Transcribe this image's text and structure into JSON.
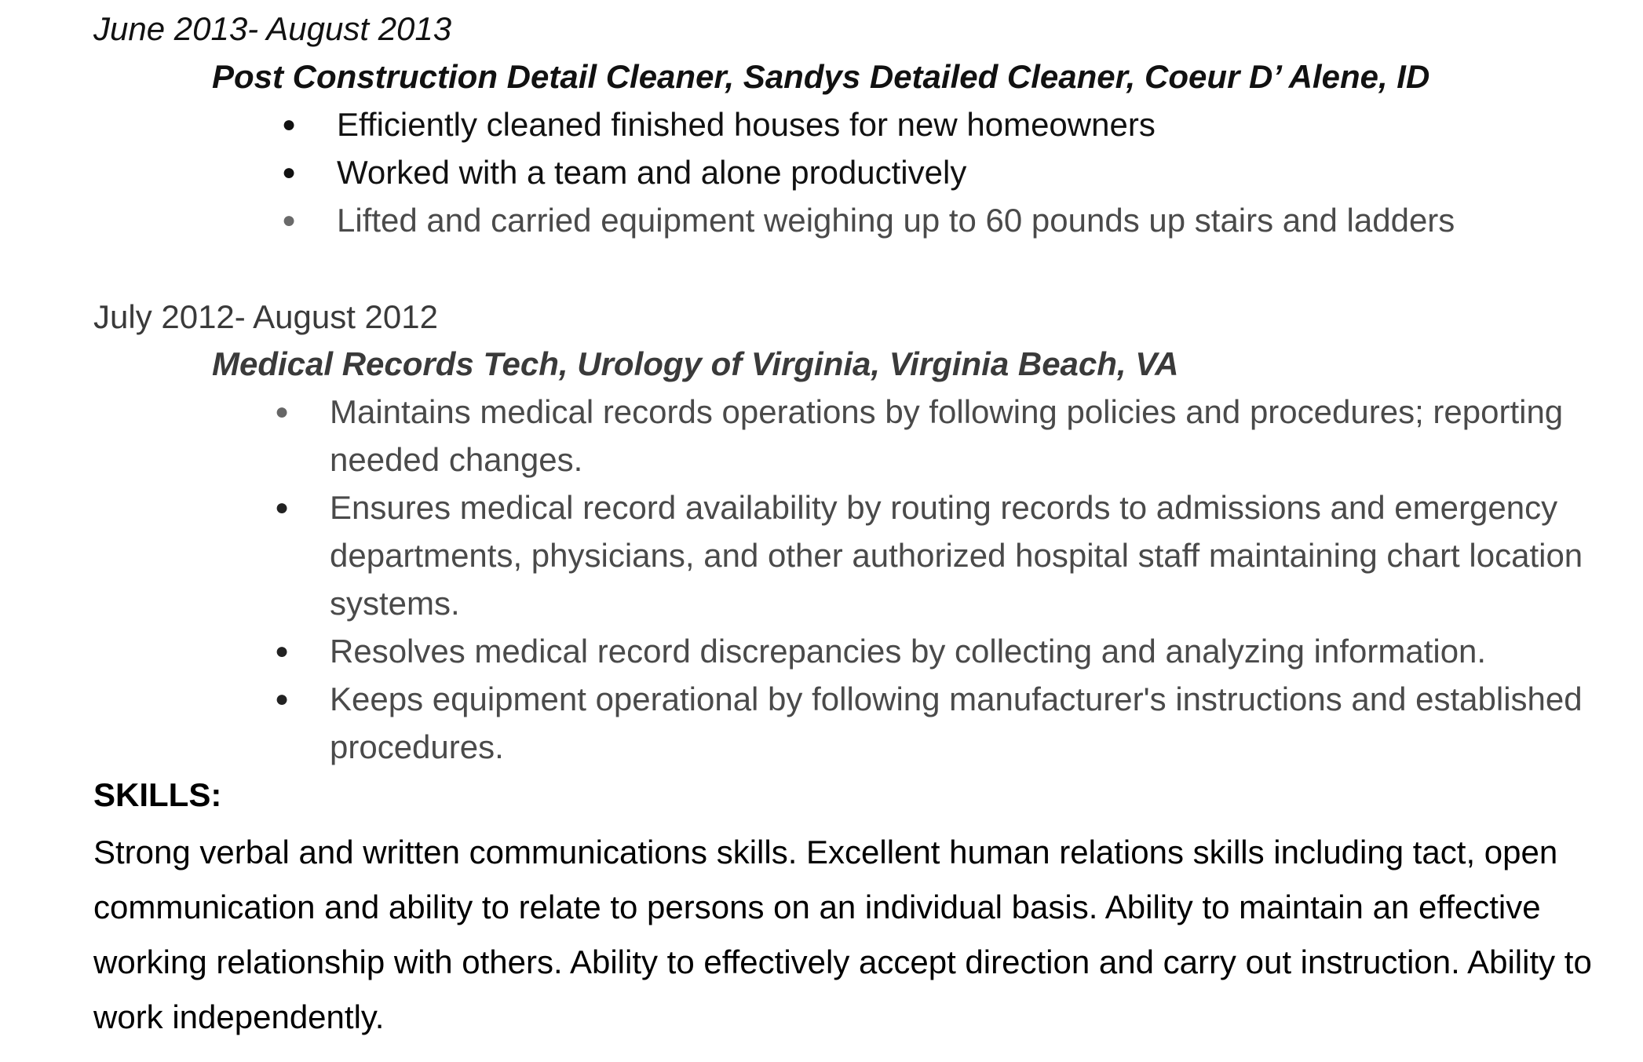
{
  "jobs": [
    {
      "dates": "June 2013- August 2013",
      "title": "Post Construction Detail Cleaner, Sandys Detailed Cleaner, Coeur D’ Alene, ID",
      "bullets": [
        "Efficiently cleaned finished houses for new homeowners",
        "Worked with a team and alone productively",
        "Lifted and carried equipment weighing up to 60 pounds up stairs and ladders"
      ]
    },
    {
      "dates": "July 2012-  August 2012",
      "title": "Medical Records Tech, Urology of Virginia, Virginia Beach, VA",
      "bullets": [
        "Maintains medical records operations by following policies and procedures; reporting needed changes.",
        "Ensures medical record availability by routing records to admissions and emergency departments, physicians, and other authorized hospital staff maintaining chart location systems.",
        "Resolves medical record discrepancies by collecting and analyzing information.",
        "Keeps equipment operational by following manufacturer's instructions and established procedures."
      ]
    }
  ],
  "bullet_glyph": "●",
  "skills": {
    "heading": "SKILLS:",
    "text": "Strong verbal and written communications skills. Excellent human relations skills including tact, open communication and ability to relate to persons on an individual basis. Ability to maintain an effective working relationship with others. Ability to effectively accept direction and carry out instruction. Ability to work independently."
  }
}
